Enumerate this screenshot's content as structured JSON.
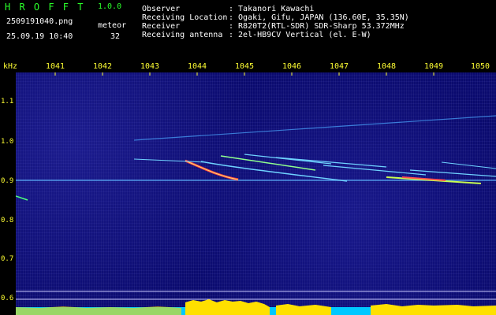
{
  "app": {
    "name": "H R O F F T",
    "version": "1.0.0"
  },
  "capture": {
    "filename": "2509191040.png",
    "timestamp": "25.09.19 10:40",
    "meteor_label": "meteor",
    "meteor_count": "32"
  },
  "station": {
    "observer_label": "Observer",
    "observer_value": ": Takanori Kawachi",
    "location_label": "Receiving Location",
    "location_value": ": Ogaki, Gifu, JAPAN (136.60E, 35.35N)",
    "receiver_label": "Receiver",
    "receiver_value": ": R820T2(RTL-SDR) SDR-Sharp 53.372MHz",
    "antenna_label": "Receiving antenna",
    "antenna_value": ": 2el-HB9CV Vertical (el. E-W)"
  },
  "axes": {
    "y_unit": "kHz",
    "time_ticks": [
      "1041",
      "1042",
      "1043",
      "1044",
      "1045",
      "1046",
      "1047",
      "1048",
      "1049",
      "1050"
    ],
    "freq_ticks": [
      "1.1",
      "1.0",
      "0.9",
      "0.8",
      "0.7",
      "0.6"
    ]
  },
  "colors": {
    "plot_bg": "#0a0a6e",
    "tick_text": "#ffff33",
    "header_green": "#2aff2a",
    "trace": "#6fd3ff",
    "level": "#ffe000",
    "level_base": "#00c8ff"
  }
}
